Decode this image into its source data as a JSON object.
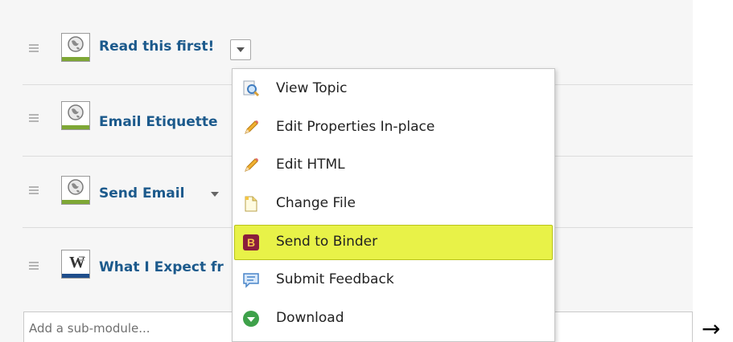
{
  "topics": [
    {
      "title": "Read this first!",
      "icon": "web-page-icon"
    },
    {
      "title": "Email Etiquette",
      "icon": "web-page-icon"
    },
    {
      "title": "Send Email",
      "icon": "web-page-icon"
    },
    {
      "title": "What I Expect fr",
      "icon": "word-document-icon"
    }
  ],
  "submodule": {
    "placeholder": "Add a sub-module..."
  },
  "menu": {
    "items": [
      {
        "label": "View Topic",
        "icon": "view-magnifier-icon"
      },
      {
        "label": "Edit Properties In-place",
        "icon": "pencil-icon"
      },
      {
        "label": "Edit HTML",
        "icon": "pencil-icon"
      },
      {
        "label": "Change File",
        "icon": "file-icon"
      },
      {
        "label": "Send to Binder",
        "icon": "binder-b-icon",
        "highlighted": true
      },
      {
        "label": "Submit Feedback",
        "icon": "feedback-bubble-icon"
      },
      {
        "label": "Download",
        "icon": "download-icon"
      }
    ]
  },
  "right_arrow": "→",
  "colors": {
    "title": "#1c5a8c",
    "highlight": "#e8f248",
    "web_bar": "#7ea735",
    "binder": "#8a1e3c"
  }
}
